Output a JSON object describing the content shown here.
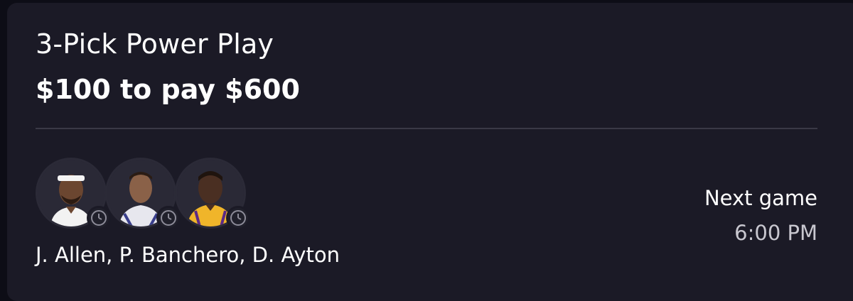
{
  "entry": {
    "title": "3-Pick Power Play",
    "wager": "$100 to pay $600",
    "players_summary": "J. Allen, P. Banchero, D. Ayton",
    "next_game_label": "Next game",
    "next_game_time": "6:00 PM"
  },
  "avatars": [
    {
      "player": "J. Allen",
      "icon": "clock-icon",
      "jersey_color": "#f2f2f2"
    },
    {
      "player": "P. Banchero",
      "icon": "clock-icon",
      "jersey_color": "#e7e7ee"
    },
    {
      "player": "D. Ayton",
      "icon": "clock-icon",
      "jersey_color": "#f0b52a"
    }
  ],
  "colors": {
    "card_background": "#1b1a26",
    "page_background": "#0d0d16",
    "divider": "#3a3946",
    "text_primary": "#ffffff",
    "text_secondary": "#c8c7cf"
  }
}
